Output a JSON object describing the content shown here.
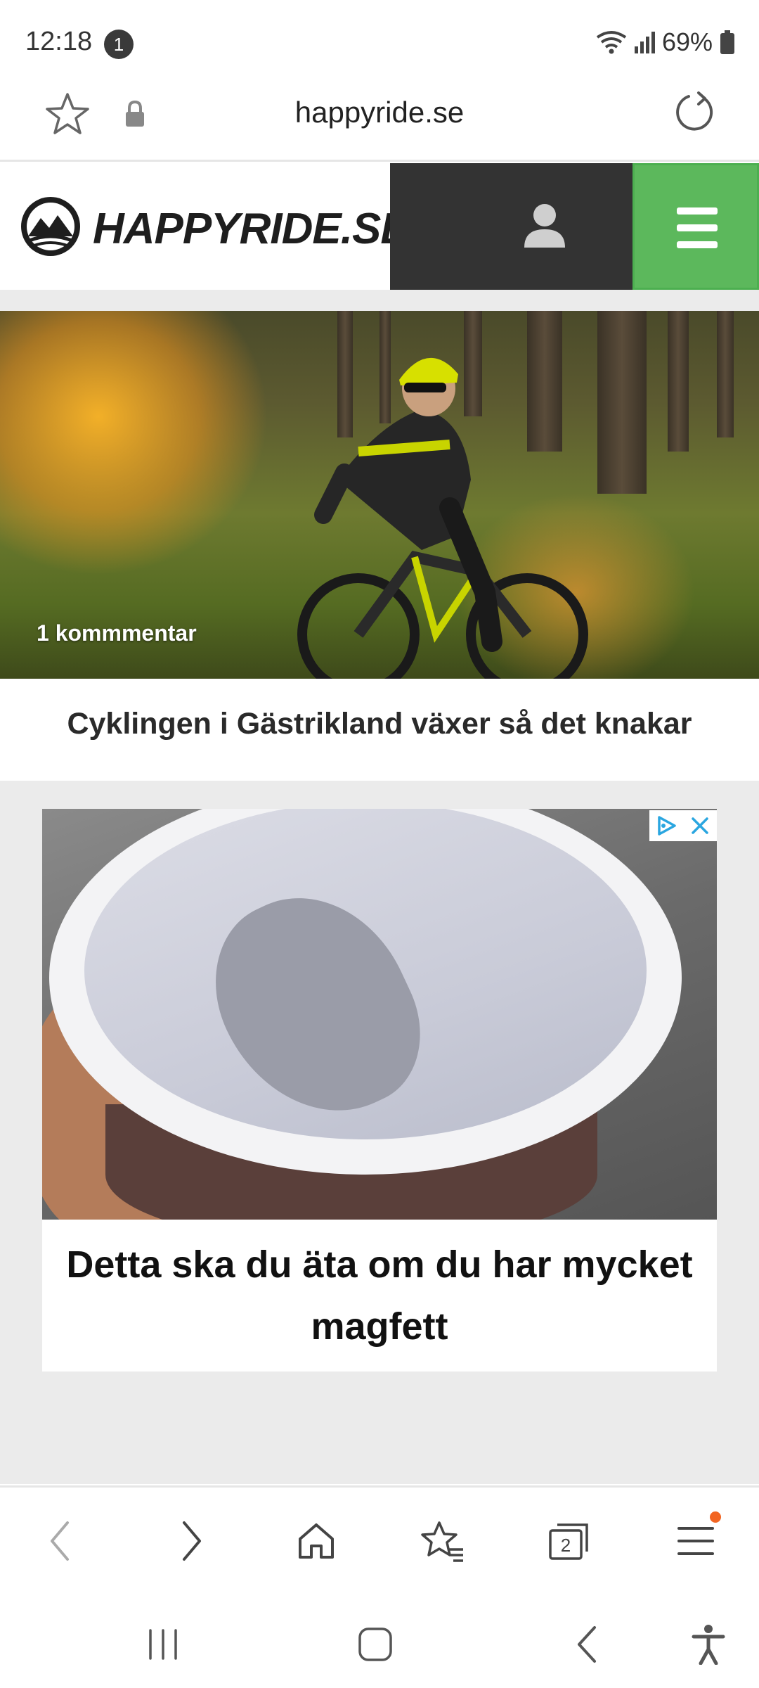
{
  "status_bar": {
    "time": "12:18",
    "notification_count": "1",
    "battery": "69%"
  },
  "browser": {
    "url": "happyride.se"
  },
  "site": {
    "logo_text": "HAPPYRIDE.SE",
    "colors": {
      "menu_green": "#5cb85c",
      "header_dark": "#333333"
    }
  },
  "hero": {
    "comment_count": "1 kommmentar",
    "title": "Cyklingen i Gästrikland växer så det knakar"
  },
  "ad": {
    "headline": "Detta ska du äta om du har mycket magfett"
  },
  "toolbar": {
    "icons": [
      "back-icon",
      "forward-icon",
      "home-icon",
      "bookmarks-icon",
      "tabs-icon",
      "menu-icon"
    ],
    "tabs_count": "2"
  }
}
